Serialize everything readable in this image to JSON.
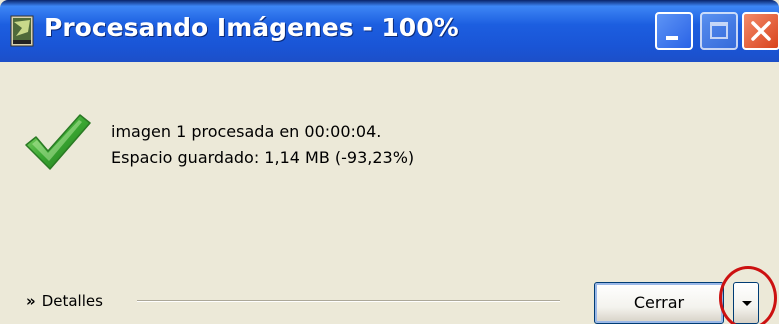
{
  "window": {
    "title": "Procesando Imágenes - 100%"
  },
  "message": {
    "line1": "imagen 1  procesada en 00:00:04.",
    "line2": "Espacio guardado: 1,14 MB (-93,23%)"
  },
  "footer": {
    "details_arrow": "»",
    "details_label": "Detalles",
    "close_label": "Cerrar"
  },
  "icons": {
    "success": "checkmark-icon",
    "app": "app-icon",
    "dropdown": "chevron-down-icon"
  },
  "colors": {
    "titlebar": "#1c5ee0",
    "window_bg": "#ece9d8",
    "highlight": "#cc1111",
    "check": "#3aa832"
  }
}
